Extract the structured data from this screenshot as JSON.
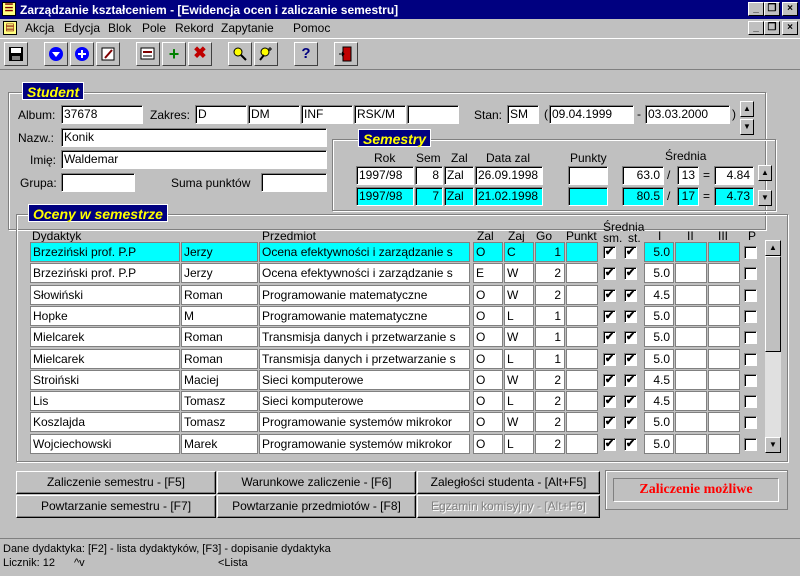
{
  "window": {
    "title": "Zarządzanie kształceniem - [Ewidencja ocen i zaliczanie semestru]",
    "controls": [
      "_",
      "❐",
      "×"
    ]
  },
  "menu": [
    "Akcja",
    "Edycja",
    "Blok",
    "Pole",
    "Rekord",
    "Zapytanie",
    "Pomoc"
  ],
  "mdi_controls": [
    "_",
    "❐",
    "×"
  ],
  "student": {
    "group_title": "Student",
    "album_label": "Album:",
    "album": "37678",
    "zakres_label": "Zakres:",
    "zakres": [
      "D",
      "DM",
      "INF",
      "RSK/M",
      ""
    ],
    "stan_label": "Stan:",
    "stan": "SM",
    "date_from": "09.04.1999",
    "date_to": "03.03.2000",
    "paren_open": "(",
    "dash": "-",
    "paren_close": ")",
    "nazw_label": "Nazw.:",
    "nazw": "Konik",
    "imie_label": "Imię:",
    "imie": "Waldemar",
    "grupa_label": "Grupa:",
    "grupa": "",
    "suma_label": "Suma punktów",
    "suma": ""
  },
  "semestry": {
    "group_title": "Semestry",
    "headers": {
      "rok": "Rok",
      "sem": "Sem",
      "zal": "Zal",
      "data": "Data zal",
      "punkty": "Punkty",
      "srednia": "Średnia"
    },
    "rows": [
      {
        "rok": "1997/98",
        "sem": "8",
        "zal": "Zal",
        "data": "26.09.1998",
        "punkty": "",
        "a": "63.0",
        "sep": "/",
        "b": "13",
        "eq": "=",
        "avg": "4.84"
      },
      {
        "rok": "1997/98",
        "sem": "7",
        "zal": "Zal",
        "data": "21.02.1998",
        "punkty": "",
        "a": "80.5",
        "sep": "/",
        "b": "17",
        "eq": "=",
        "avg": "4.73"
      }
    ]
  },
  "oceny": {
    "group_title": "Oceny w semestrze",
    "headers": {
      "dydaktyk": "Dydaktyk",
      "przedmiot": "Przedmiot",
      "zal": "Zal",
      "zaj": "Zaj",
      "go": "Go",
      "punkt": "Punkt",
      "srednia": "Średnia",
      "sm": "sm.",
      "st": "st.",
      "i": "I",
      "ii": "II",
      "iii": "III",
      "p": "P"
    },
    "rows": [
      {
        "nazwisko": "Brzeziński prof. P.P",
        "imie": "Jerzy",
        "przedmiot": "Ocena efektywności i zarządzanie s",
        "zal": "O",
        "zaj": "C",
        "go": "1",
        "punkt": "",
        "sm": true,
        "st": true,
        "i": "5.0",
        "ii": "",
        "iii": "",
        "p": false
      },
      {
        "nazwisko": "Brzeziński prof. P.P",
        "imie": "Jerzy",
        "przedmiot": "Ocena efektywności i zarządzanie s",
        "zal": "E",
        "zaj": "W",
        "go": "2",
        "punkt": "",
        "sm": true,
        "st": true,
        "i": "5.0",
        "ii": "",
        "iii": "",
        "p": false
      },
      {
        "nazwisko": "Słowiński",
        "imie": "Roman",
        "przedmiot": "Programowanie matematyczne",
        "zal": "O",
        "zaj": "W",
        "go": "2",
        "punkt": "",
        "sm": true,
        "st": true,
        "i": "4.5",
        "ii": "",
        "iii": "",
        "p": false
      },
      {
        "nazwisko": "Hopke",
        "imie": "M",
        "przedmiot": "Programowanie matematyczne",
        "zal": "O",
        "zaj": "L",
        "go": "1",
        "punkt": "",
        "sm": true,
        "st": true,
        "i": "5.0",
        "ii": "",
        "iii": "",
        "p": false
      },
      {
        "nazwisko": "Mielcarek",
        "imie": "Roman",
        "przedmiot": "Transmisja danych i przetwarzanie s",
        "zal": "O",
        "zaj": "W",
        "go": "1",
        "punkt": "",
        "sm": true,
        "st": true,
        "i": "5.0",
        "ii": "",
        "iii": "",
        "p": false
      },
      {
        "nazwisko": "Mielcarek",
        "imie": "Roman",
        "przedmiot": "Transmisja danych i przetwarzanie s",
        "zal": "O",
        "zaj": "L",
        "go": "1",
        "punkt": "",
        "sm": true,
        "st": true,
        "i": "5.0",
        "ii": "",
        "iii": "",
        "p": false
      },
      {
        "nazwisko": "Stroiński",
        "imie": "Maciej",
        "przedmiot": "Sieci komputerowe",
        "zal": "O",
        "zaj": "W",
        "go": "2",
        "punkt": "",
        "sm": true,
        "st": true,
        "i": "4.5",
        "ii": "",
        "iii": "",
        "p": false
      },
      {
        "nazwisko": "Lis",
        "imie": "Tomasz",
        "przedmiot": "Sieci komputerowe",
        "zal": "O",
        "zaj": "L",
        "go": "2",
        "punkt": "",
        "sm": true,
        "st": true,
        "i": "4.5",
        "ii": "",
        "iii": "",
        "p": false
      },
      {
        "nazwisko": "Koszlajda",
        "imie": "Tomasz",
        "przedmiot": "Programowanie systemów mikrokor",
        "zal": "O",
        "zaj": "W",
        "go": "2",
        "punkt": "",
        "sm": true,
        "st": true,
        "i": "5.0",
        "ii": "",
        "iii": "",
        "p": false
      },
      {
        "nazwisko": "Wojciechowski",
        "imie": "Marek",
        "przedmiot": "Programowanie systemów mikrokor",
        "zal": "O",
        "zaj": "L",
        "go": "2",
        "punkt": "",
        "sm": true,
        "st": true,
        "i": "5.0",
        "ii": "",
        "iii": "",
        "p": false
      }
    ]
  },
  "buttons": {
    "zaliczenie": "Zaliczenie semestru - [F5]",
    "warunkowe": "Warunkowe zaliczenie - [F6]",
    "zaleglosci": "Zaległości studenta - [Alt+F5]",
    "powtarzanie_sem": "Powtarzanie semestru - [F7]",
    "powtarzanie_przed": "Powtarzanie przedmiotów - [F8]",
    "egzamin": "Egzamin komisyjny - [Alt+F6]"
  },
  "status_message": "Zaliczenie możliwe",
  "statusbar": {
    "hint": "Dane dydaktyka: [F2] - lista dydaktyków, [F3] - dopisanie dydaktyka",
    "licznik": "Licznik: 12",
    "nav": "^v",
    "lista": "<Lista"
  },
  "colors": {
    "title_bg": "#000080",
    "highlight": "#00ffff",
    "group_title_fg": "#ffff00",
    "status_msg": "#ff0000"
  }
}
